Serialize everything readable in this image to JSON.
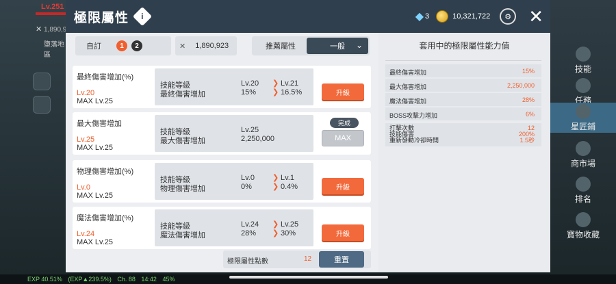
{
  "hud": {
    "level": "Lv.251",
    "combat_power": "1,890,9",
    "map_name": "墮落地區",
    "bottom_bar": [
      "EXP 40.51%",
      "(EXP▲239.5%)",
      "Ch. 88",
      "14:42",
      "45%"
    ]
  },
  "right_menu": [
    "技能",
    "任務",
    "星匠鋪",
    "商市場",
    "排名",
    "寶物收藏"
  ],
  "header": {
    "title": "極限屬性",
    "gems": "3",
    "coins": "10,321,722"
  },
  "toolbar": {
    "preset_label": "自訂",
    "presets": [
      "1",
      "2"
    ],
    "cost": "1,890,923",
    "recommend_label": "推薦屬性",
    "recommend_value": "一般"
  },
  "cards": [
    {
      "name": "最終傷害增加(%)",
      "level": "Lv.20",
      "max": "MAX Lv.25",
      "row1_label": "技能等級",
      "row2_label": "最終傷害增加",
      "cur1": "Lv.20",
      "cur2": "15%",
      "next1": "Lv.21",
      "next2": "16.5%",
      "button": "升級"
    },
    {
      "name": "最大傷害增加",
      "level": "Lv.25",
      "max": "MAX Lv.25",
      "row1_label": "技能等級",
      "row2_label": "最大傷害增加",
      "cur1": "Lv.25",
      "cur2": "2,250,000",
      "done": "完成",
      "button": "MAX"
    },
    {
      "name": "物理傷害增加(%)",
      "level": "Lv.0",
      "max": "MAX Lv.25",
      "row1_label": "技能等級",
      "row2_label": "物理傷害增加",
      "cur1": "Lv.0",
      "cur2": "0%",
      "next1": "Lv.1",
      "next2": "0.4%",
      "button": "升級"
    },
    {
      "name": "魔法傷害增加(%)",
      "level": "Lv.24",
      "max": "MAX Lv.25",
      "row1_label": "技能等級",
      "row2_label": "魔法傷害增加",
      "cur1": "Lv.24",
      "cur2": "28%",
      "next1": "Lv.25",
      "next2": "30%",
      "button": "升級"
    }
  ],
  "footer": {
    "points_label": "極限屬性點數",
    "points": "12",
    "reset": "重置"
  },
  "summary": {
    "title": "套用中的極限屬性能力值",
    "rows": [
      {
        "k": "最終傷害增加",
        "v": "15%"
      },
      {
        "k": "最大傷害增加",
        "v": "2,250,000"
      },
      {
        "k": "魔法傷害增加",
        "v": "28%"
      },
      {
        "k": "BOSS攻擊力增加",
        "v": "6%"
      }
    ],
    "multi_keys": [
      "打擊次數",
      "技能傷害",
      "重新發動冷卻時間"
    ],
    "multi_vals": [
      "12",
      "200%",
      "1.5秒"
    ]
  },
  "colors": {
    "accent": "#f26a3c",
    "header_bg": "#2f3f4d",
    "value_orange": "#f05f2d"
  }
}
